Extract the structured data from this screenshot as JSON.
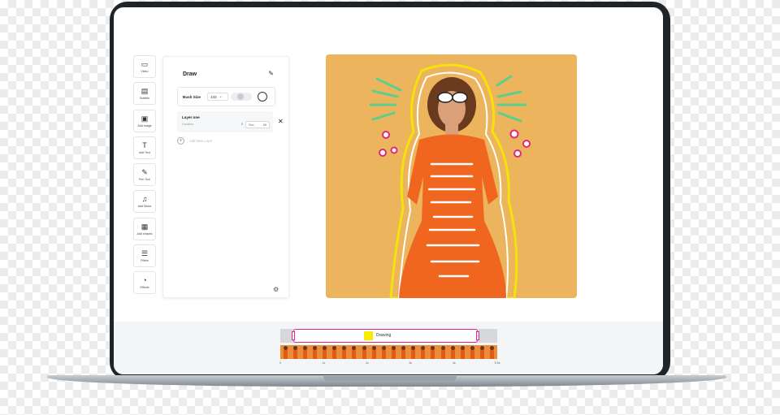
{
  "app": {
    "tools": [
      {
        "icon": "video-camera-icon",
        "glyph": "▭",
        "label": "Video"
      },
      {
        "icon": "subtitle-icon",
        "glyph": "▤",
        "label": "Subtitle"
      },
      {
        "icon": "image-icon",
        "glyph": "▣",
        "label": "Add image"
      },
      {
        "icon": "text-icon",
        "glyph": "T",
        "label": "Add Text"
      },
      {
        "icon": "pen-icon",
        "glyph": "✎",
        "label": "Pen Tool"
      },
      {
        "icon": "music-icon",
        "glyph": "♫",
        "label": "Add Music"
      },
      {
        "icon": "shapes-icon",
        "glyph": "▦",
        "label": "Add shapes"
      },
      {
        "icon": "filters-icon",
        "glyph": "☰",
        "label": "Filters"
      },
      {
        "icon": "effects-icon",
        "glyph": "◔",
        "label": "Effects"
      }
    ],
    "draw_panel": {
      "title": "Draw",
      "brush_label": "Bush Size",
      "brush_value": "132",
      "brush_chevron": "⌄",
      "layer_name": "Layer one",
      "layer_sub": "Duration",
      "layer_start": "0",
      "layer_input_label": "Sec",
      "layer_input_value": "65",
      "add_layer_label": "Add New Layer",
      "add_glyph": "+",
      "close_glyph": "✕",
      "edit_glyph": "✎",
      "settings_glyph": "⚙"
    },
    "timeline": {
      "clip_label": "Drawing",
      "clip_color": "#f7ec00",
      "accent_color": "#e0278a",
      "handle_left": "‹",
      "handle_right": "›",
      "ticks": [
        "0",
        "1s",
        "2s",
        "3s",
        "4s",
        "5.5s"
      ]
    }
  }
}
